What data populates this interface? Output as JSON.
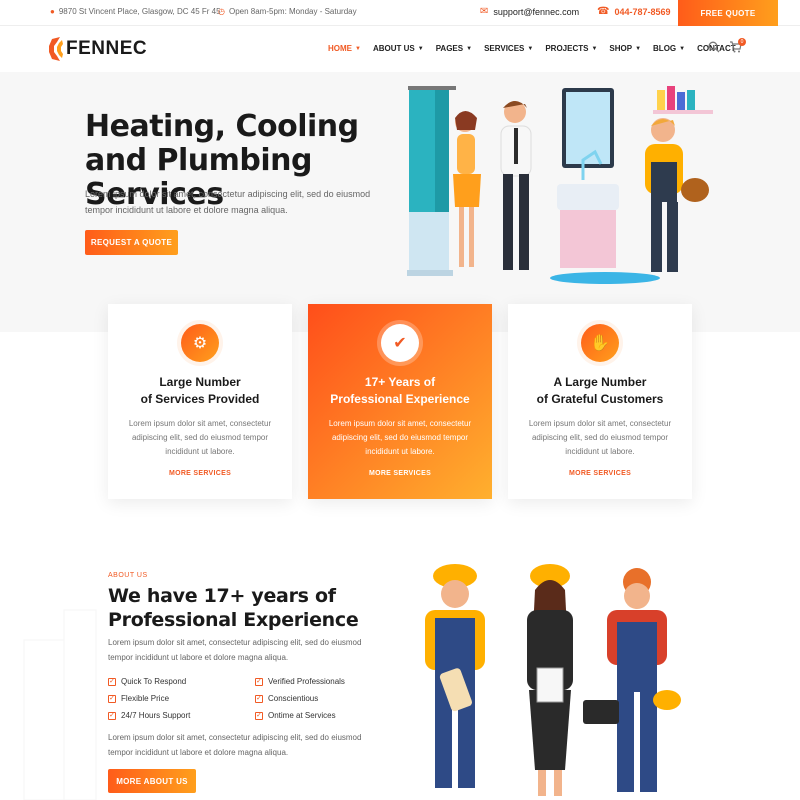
{
  "topbar": {
    "address": "9870 St Vincent Place, Glasgow, DC 45 Fr 45",
    "hours": "Open 8am-5pm: Monday - Saturday",
    "email": "support@fennec.com",
    "phone": "044-787-8569",
    "cta": "FREE QUOTE",
    "icons": [
      "map-pin-icon",
      "clock-icon",
      "mail-icon",
      "phone-icon"
    ]
  },
  "nav": {
    "logo": "FENNEC",
    "items": [
      {
        "label": "HOME",
        "active": true
      },
      {
        "label": "ABOUT US"
      },
      {
        "label": "PAGES"
      },
      {
        "label": "SERVICES"
      },
      {
        "label": "PROJECTS"
      },
      {
        "label": "SHOP"
      },
      {
        "label": "BLOG"
      },
      {
        "label": "CONTACT"
      }
    ],
    "cart_count": "0"
  },
  "hero": {
    "title": "Heating, Cooling and Plumbing Services",
    "text": "Lorem ipsum dolor sit amet, consectetur adipiscing elit, sed do eiusmod tempor incididunt ut labore et dolore magna aliqua.",
    "button": "REQUEST A QUOTE"
  },
  "cards": [
    {
      "title_1": "Large Number",
      "title_2": "of Services Provided",
      "text": "Lorem ipsum dolor sit amet, consectetur adipiscing elit, sed do eiusmod tempor incididunt ut labore.",
      "link": "MORE SERVICES",
      "icon": "gear-icon"
    },
    {
      "title_1": "17+ Years of",
      "title_2": "Professional Experience",
      "text": "Lorem ipsum dolor sit amet, consectetur adipiscing elit, sed do eiusmod tempor incididunt ut labore.",
      "link": "MORE SERVICES",
      "icon": "certificate-icon"
    },
    {
      "title_1": "A Large Number",
      "title_2": "of Grateful Customers",
      "text": "Lorem ipsum dolor sit amet, consectetur adipiscing elit, sed do eiusmod tempor incididunt ut labore.",
      "link": "MORE SERVICES",
      "icon": "handshake-icon"
    }
  ],
  "about": {
    "tag": "ABOUT US",
    "title_1": "We have 17+ years of",
    "title_2": "Professional Experience",
    "text_1": "Lorem ipsum dolor sit amet, consectetur adipiscing elit, sed do eiusmod tempor incididunt ut labore et dolore magna aliqua.",
    "features": [
      "Quick To Respond",
      "Verified Professionals",
      "Flexible Price",
      "Conscientious",
      "24/7 Hours Support",
      "Ontime at Services"
    ],
    "text_2": "Lorem ipsum dolor sit amet, consectetur adipiscing elit, sed do eiusmod tempor incididunt ut labore et dolore magna aliqua.",
    "button": "MORE ABOUT US"
  },
  "colors": {
    "accent": "#f15a24",
    "accent_2": "#ff9f1c"
  }
}
